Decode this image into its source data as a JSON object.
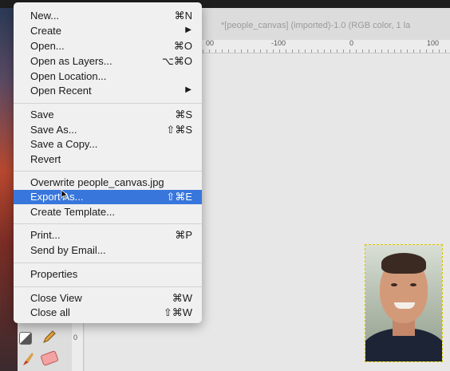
{
  "window_title": "*[people_canvas] (imported)-1.0 (RGB color, 1 la",
  "ruler": {
    "top_ticks": [
      "00",
      "-100",
      "0",
      "100"
    ],
    "left_ticks": [
      "0"
    ]
  },
  "menu": {
    "groups": [
      [
        {
          "label": "New...",
          "shortcut": "⌘N"
        },
        {
          "label": "Create",
          "submenu": true
        },
        {
          "label": "Open...",
          "shortcut": "⌘O"
        },
        {
          "label": "Open as Layers...",
          "shortcut": "⌥⌘O"
        },
        {
          "label": "Open Location..."
        },
        {
          "label": "Open Recent",
          "submenu": true
        }
      ],
      [
        {
          "label": "Save",
          "shortcut": "⌘S"
        },
        {
          "label": "Save As...",
          "shortcut": "⇧⌘S"
        },
        {
          "label": "Save a Copy..."
        },
        {
          "label": "Revert"
        }
      ],
      [
        {
          "label": "Overwrite people_canvas.jpg"
        },
        {
          "label": "Export As...",
          "shortcut": "⇧⌘E",
          "highlighted": true
        },
        {
          "label": "Create Template..."
        }
      ],
      [
        {
          "label": "Print...",
          "shortcut": "⌘P"
        },
        {
          "label": "Send by Email..."
        }
      ],
      [
        {
          "label": "Properties"
        }
      ],
      [
        {
          "label": "Close View",
          "shortcut": "⌘W"
        },
        {
          "label": "Close all",
          "shortcut": "⇧⌘W"
        }
      ]
    ],
    "submenu_arrow": "▶"
  },
  "colors": {
    "highlight": "#3876dc"
  }
}
